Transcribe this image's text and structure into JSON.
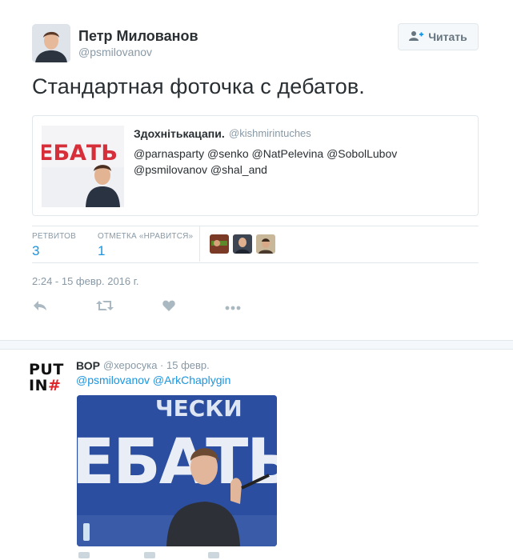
{
  "main_tweet": {
    "author_name": "Петр Милованов",
    "author_handle": "@psmilovanov",
    "follow_label": "Читать",
    "text": "Стандартная фоточка с дебатов.",
    "quote": {
      "name": "Здохнітькацапи.",
      "handle": "@kishmirintuches",
      "text_line1": "@parnasparty @senko @NatPelevina @SobolLubov",
      "text_line2": "@psmilovanov @shal_and",
      "image_text": "ЕБАТЬ"
    },
    "stats": {
      "retweets_label": "РЕТВИТОВ",
      "retweets_value": "3",
      "likes_label": "ОТМЕТКА «НРАВИТСЯ»",
      "likes_value": "1"
    },
    "timestamp": "2:24 - 15 февр. 2016 г.",
    "actions": [
      "reply-icon",
      "retweet-icon",
      "like-icon",
      "more-icon"
    ]
  },
  "reply_tweet": {
    "avatar_line1": "PUT",
    "avatar_line2": "IN",
    "avatar_hash": "#",
    "name": "ВОР",
    "meta": "@херосука · 15 февр.",
    "mentions": "@psmilovanov @ArkChaplygin",
    "photo_text": "ЕБАТЬ",
    "photo_top_text": "ЧЕСКИ"
  },
  "colors": {
    "link": "#1b95e0",
    "secondary": "#8899a6",
    "border": "#e1e8ed",
    "text": "#292f33",
    "accent_red": "#e0262b",
    "banner_blue": "#2b4ea0"
  }
}
